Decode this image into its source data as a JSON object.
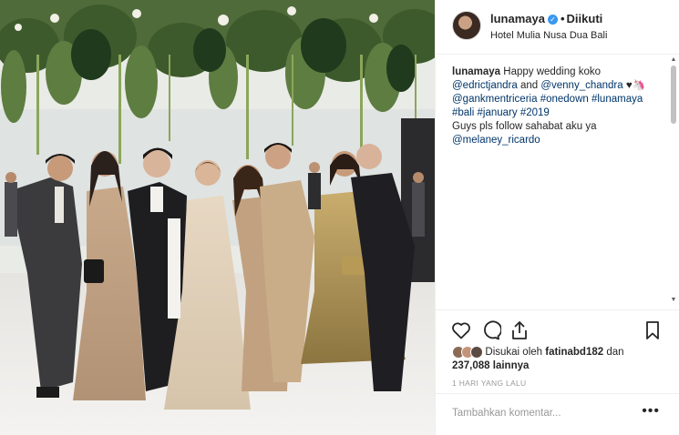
{
  "post": {
    "username": "lunamaya",
    "follow_status": "Diikuti",
    "location": "Hotel Mulia Nusa Dua Bali",
    "caption": {
      "username": "lunamaya",
      "text_1": " Happy wedding koko",
      "mention_1": "@edrictjandra",
      "and": " and ",
      "mention_2": "@venny_chandra",
      "emoji": " ♥🦄",
      "mention_3": "@gankmentriceria",
      "hashtag_1": "#onedown",
      "hashtag_2": "#lunamaya",
      "hashtag_3": "#bali",
      "hashtag_4": "#january",
      "hashtag_5": "#2019",
      "text_2": "Guys pls follow sahabat aku ya",
      "mention_4": "@melaney_ricardo"
    },
    "likes": {
      "prefix": "Disukai oleh ",
      "user": "fatinabd182",
      "middle": " dan",
      "count": "237,088",
      "suffix": " lainnya"
    },
    "date": "1 HARI YANG LALU",
    "comment_placeholder": "Tambahkan komentar...",
    "more_options": "•••"
  },
  "icons": {
    "heart": "heart-icon",
    "comment": "comment-icon",
    "share": "share-icon",
    "bookmark": "bookmark-icon",
    "verified": "verified-icon"
  },
  "colors": {
    "text": "#262626",
    "link": "#003569",
    "verified": "#3897f0",
    "muted": "#999999"
  }
}
